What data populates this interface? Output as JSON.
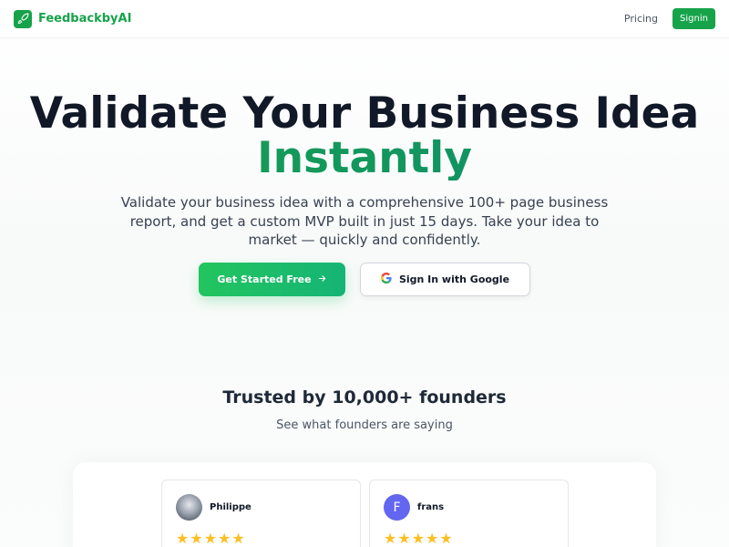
{
  "nav": {
    "brand": "FeedbackbyAI",
    "links": [
      "Pricing"
    ],
    "signin_label": "Signin"
  },
  "hero": {
    "title_line1": "Validate Your Business Idea",
    "title_line2": "Instantly",
    "subtitle": "Validate your business idea with a comprehensive 100+ page business report, and get a custom MVP built in just 15 days. Take your idea to market — quickly and confidently.",
    "primary_cta": "Get Started Free",
    "secondary_cta": "Sign In with Google"
  },
  "trust": {
    "title": "Trusted by 10,000+ founders",
    "subtitle": "See what founders are saying"
  },
  "testimonials": [
    {
      "author": "Philippe",
      "avatar": "photo",
      "stars": "★★★★★"
    },
    {
      "author": "frans",
      "avatar_letter": "F",
      "stars": "★★★★★"
    }
  ],
  "colors": {
    "brand": "#16a34a",
    "accent_gradient_start": "#22c55e",
    "star": "#fbbf24",
    "avatar_f": "#6366f1"
  },
  "icons": {
    "brand": "rocket-icon",
    "primary_cta": "arrow-right-icon",
    "secondary_cta": "google-icon"
  }
}
